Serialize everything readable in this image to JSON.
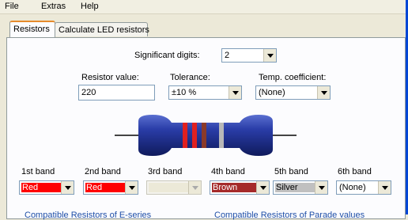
{
  "menu": [
    "File",
    "Extras",
    "Help"
  ],
  "tabs": [
    {
      "label": "Resistors",
      "active": true
    },
    {
      "label": "Calculate LED resistors",
      "active": false
    }
  ],
  "significant_digits": {
    "label": "Significant digits:",
    "value": "2"
  },
  "resistor_value": {
    "label": "Resistor value:",
    "value": "220"
  },
  "tolerance": {
    "label": "Tolerance:",
    "value": "±10 %"
  },
  "temp_coefficient": {
    "label": "Temp. coefficient:",
    "value": "(None)"
  },
  "resistor_body_color": "#1e2f8c",
  "bands_on_resistor": [
    {
      "color": "#e02020"
    },
    {
      "color": "#e02020"
    },
    {
      "color": "#8a3a2a"
    },
    {
      "color": "#b8b8b8"
    }
  ],
  "band_selectors": [
    {
      "label": "1st band",
      "value": "Red",
      "swatch": "#ff0000",
      "text_color": "#ffffff",
      "enabled": true
    },
    {
      "label": "2nd band",
      "value": "Red",
      "swatch": "#ff0000",
      "text_color": "#ffffff",
      "enabled": true
    },
    {
      "label": "3rd band",
      "value": "",
      "swatch": "#ece9d8",
      "text_color": "#000000",
      "enabled": false
    },
    {
      "label": "4th band",
      "value": "Brown",
      "swatch": "#a52a2a",
      "text_color": "#ffffff",
      "enabled": true
    },
    {
      "label": "5th band",
      "value": "Silver",
      "swatch": "#c0c0c0",
      "text_color": "#000000",
      "enabled": true
    },
    {
      "label": "6th band",
      "value": "(None)",
      "swatch": "",
      "text_color": "#000000",
      "enabled": true
    }
  ],
  "bottom_links": {
    "left": "Compatible Resistors of E-series",
    "right": "Compatible Resistors of Parade values"
  }
}
